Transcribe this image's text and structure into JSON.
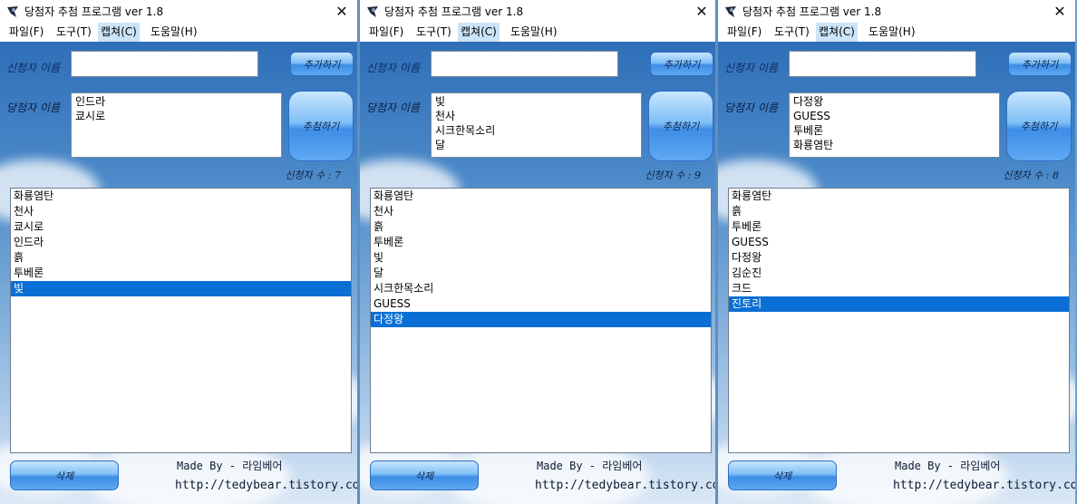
{
  "windows": [
    {
      "title": "당첨자 추첨 프로그램 ver 1.8",
      "menu": [
        "파일(F)",
        "도구(T)",
        "캡쳐(C)",
        "도움말(H)"
      ],
      "applicant_label": "신청자 이름",
      "winner_label": "당첨자 이름",
      "add_button": "추가하기",
      "draw_button": "추첨하기",
      "delete_button": "삭제",
      "applicant_input_value": "",
      "winners": [
        "인드라",
        "쿄시로"
      ],
      "count_label": "신청자 수 : 7",
      "list": [
        "화룡염탄",
        "천사",
        "쿄시로",
        "인드라",
        "흙",
        "투베론",
        "빛"
      ],
      "selected": "빛",
      "made_by": "Made By - 라임베어",
      "url": "http://tedybear.tistory.com"
    },
    {
      "title": "당첨자 추첨 프로그램 ver 1.8",
      "menu": [
        "파일(F)",
        "도구(T)",
        "캡쳐(C)",
        "도움말(H)"
      ],
      "applicant_label": "신청자 이름",
      "winner_label": "당첨자 이름",
      "add_button": "추가하기",
      "draw_button": "추첨하기",
      "delete_button": "삭제",
      "applicant_input_value": "",
      "winners": [
        "빛",
        "천사",
        "시크한목소리",
        "달"
      ],
      "count_label": "신청자 수 : 9",
      "list": [
        "화룡염탄",
        "천사",
        "흙",
        "투베론",
        "빛",
        "달",
        "시크한목소리",
        "GUESS",
        "다정왕"
      ],
      "selected": "다정왕",
      "made_by": "Made By - 라임베어",
      "url": "http://tedybear.tistory.com"
    },
    {
      "title": "당첨자 추첨 프로그램 ver 1.8",
      "menu": [
        "파일(F)",
        "도구(T)",
        "캡쳐(C)",
        "도움말(H)"
      ],
      "applicant_label": "신청자 이름",
      "winner_label": "당첨자 이름",
      "add_button": "추가하기",
      "draw_button": "추첨하기",
      "delete_button": "삭제",
      "applicant_input_value": "",
      "winners": [
        "다정왕",
        "GUESS",
        "투베론",
        "화룡염탄"
      ],
      "count_label": "신청자 수 : 8",
      "list": [
        "화룡염탄",
        "흙",
        "투베론",
        "GUESS",
        "다정왕",
        "김순진",
        "크드",
        "진토리"
      ],
      "selected": "진토리",
      "made_by": "Made By - 라임베어",
      "url": "http://tedybear.tistory.com"
    }
  ],
  "colors": {
    "selection": "#0a6fd4",
    "menu_active": "#cce4f7",
    "button_blue": "#3e8de6"
  },
  "icons": {
    "app": "bear-paw-icon",
    "close": "close-icon"
  }
}
